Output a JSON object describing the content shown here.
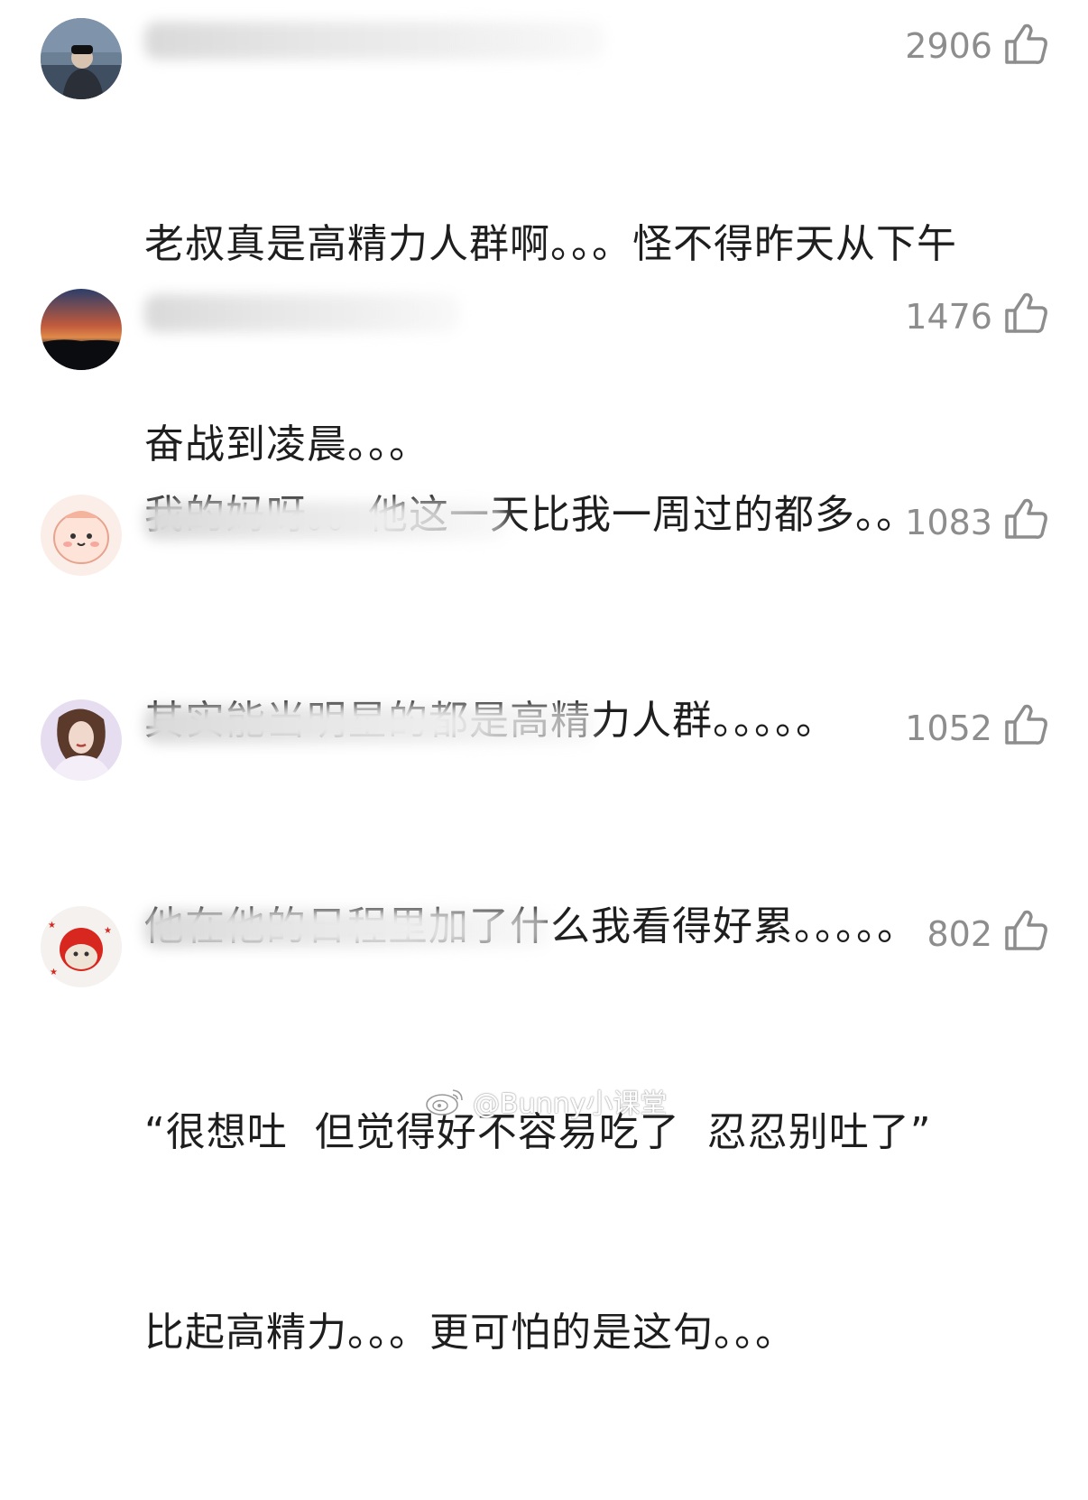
{
  "comments": [
    {
      "likes": "2906",
      "lines": [
        "老叔真是高精力人群啊。。。怪不得昨天从下午",
        "奋战到凌晨。。。"
      ]
    },
    {
      "likes": "1476",
      "lines": [
        "我的妈呀。。他这一天比我一周过的都多。。"
      ]
    },
    {
      "likes": "1083",
      "lines": [
        "其实能当明星的都是高精力人群。。。。。"
      ]
    },
    {
      "likes": "1052",
      "lines": [
        "他在他的日程里加了什么我看得好累。。。。。"
      ]
    },
    {
      "likes": "802",
      "lines": [
        "“很想吐  但觉得好不容易吃了  忍忍别吐了”",
        "比起高精力。。。更可怕的是这句。。。"
      ]
    }
  ],
  "watermark": "@Bunny小课堂",
  "colors": {
    "text": "#1e1e1e",
    "likes": "#8d8d8d"
  }
}
